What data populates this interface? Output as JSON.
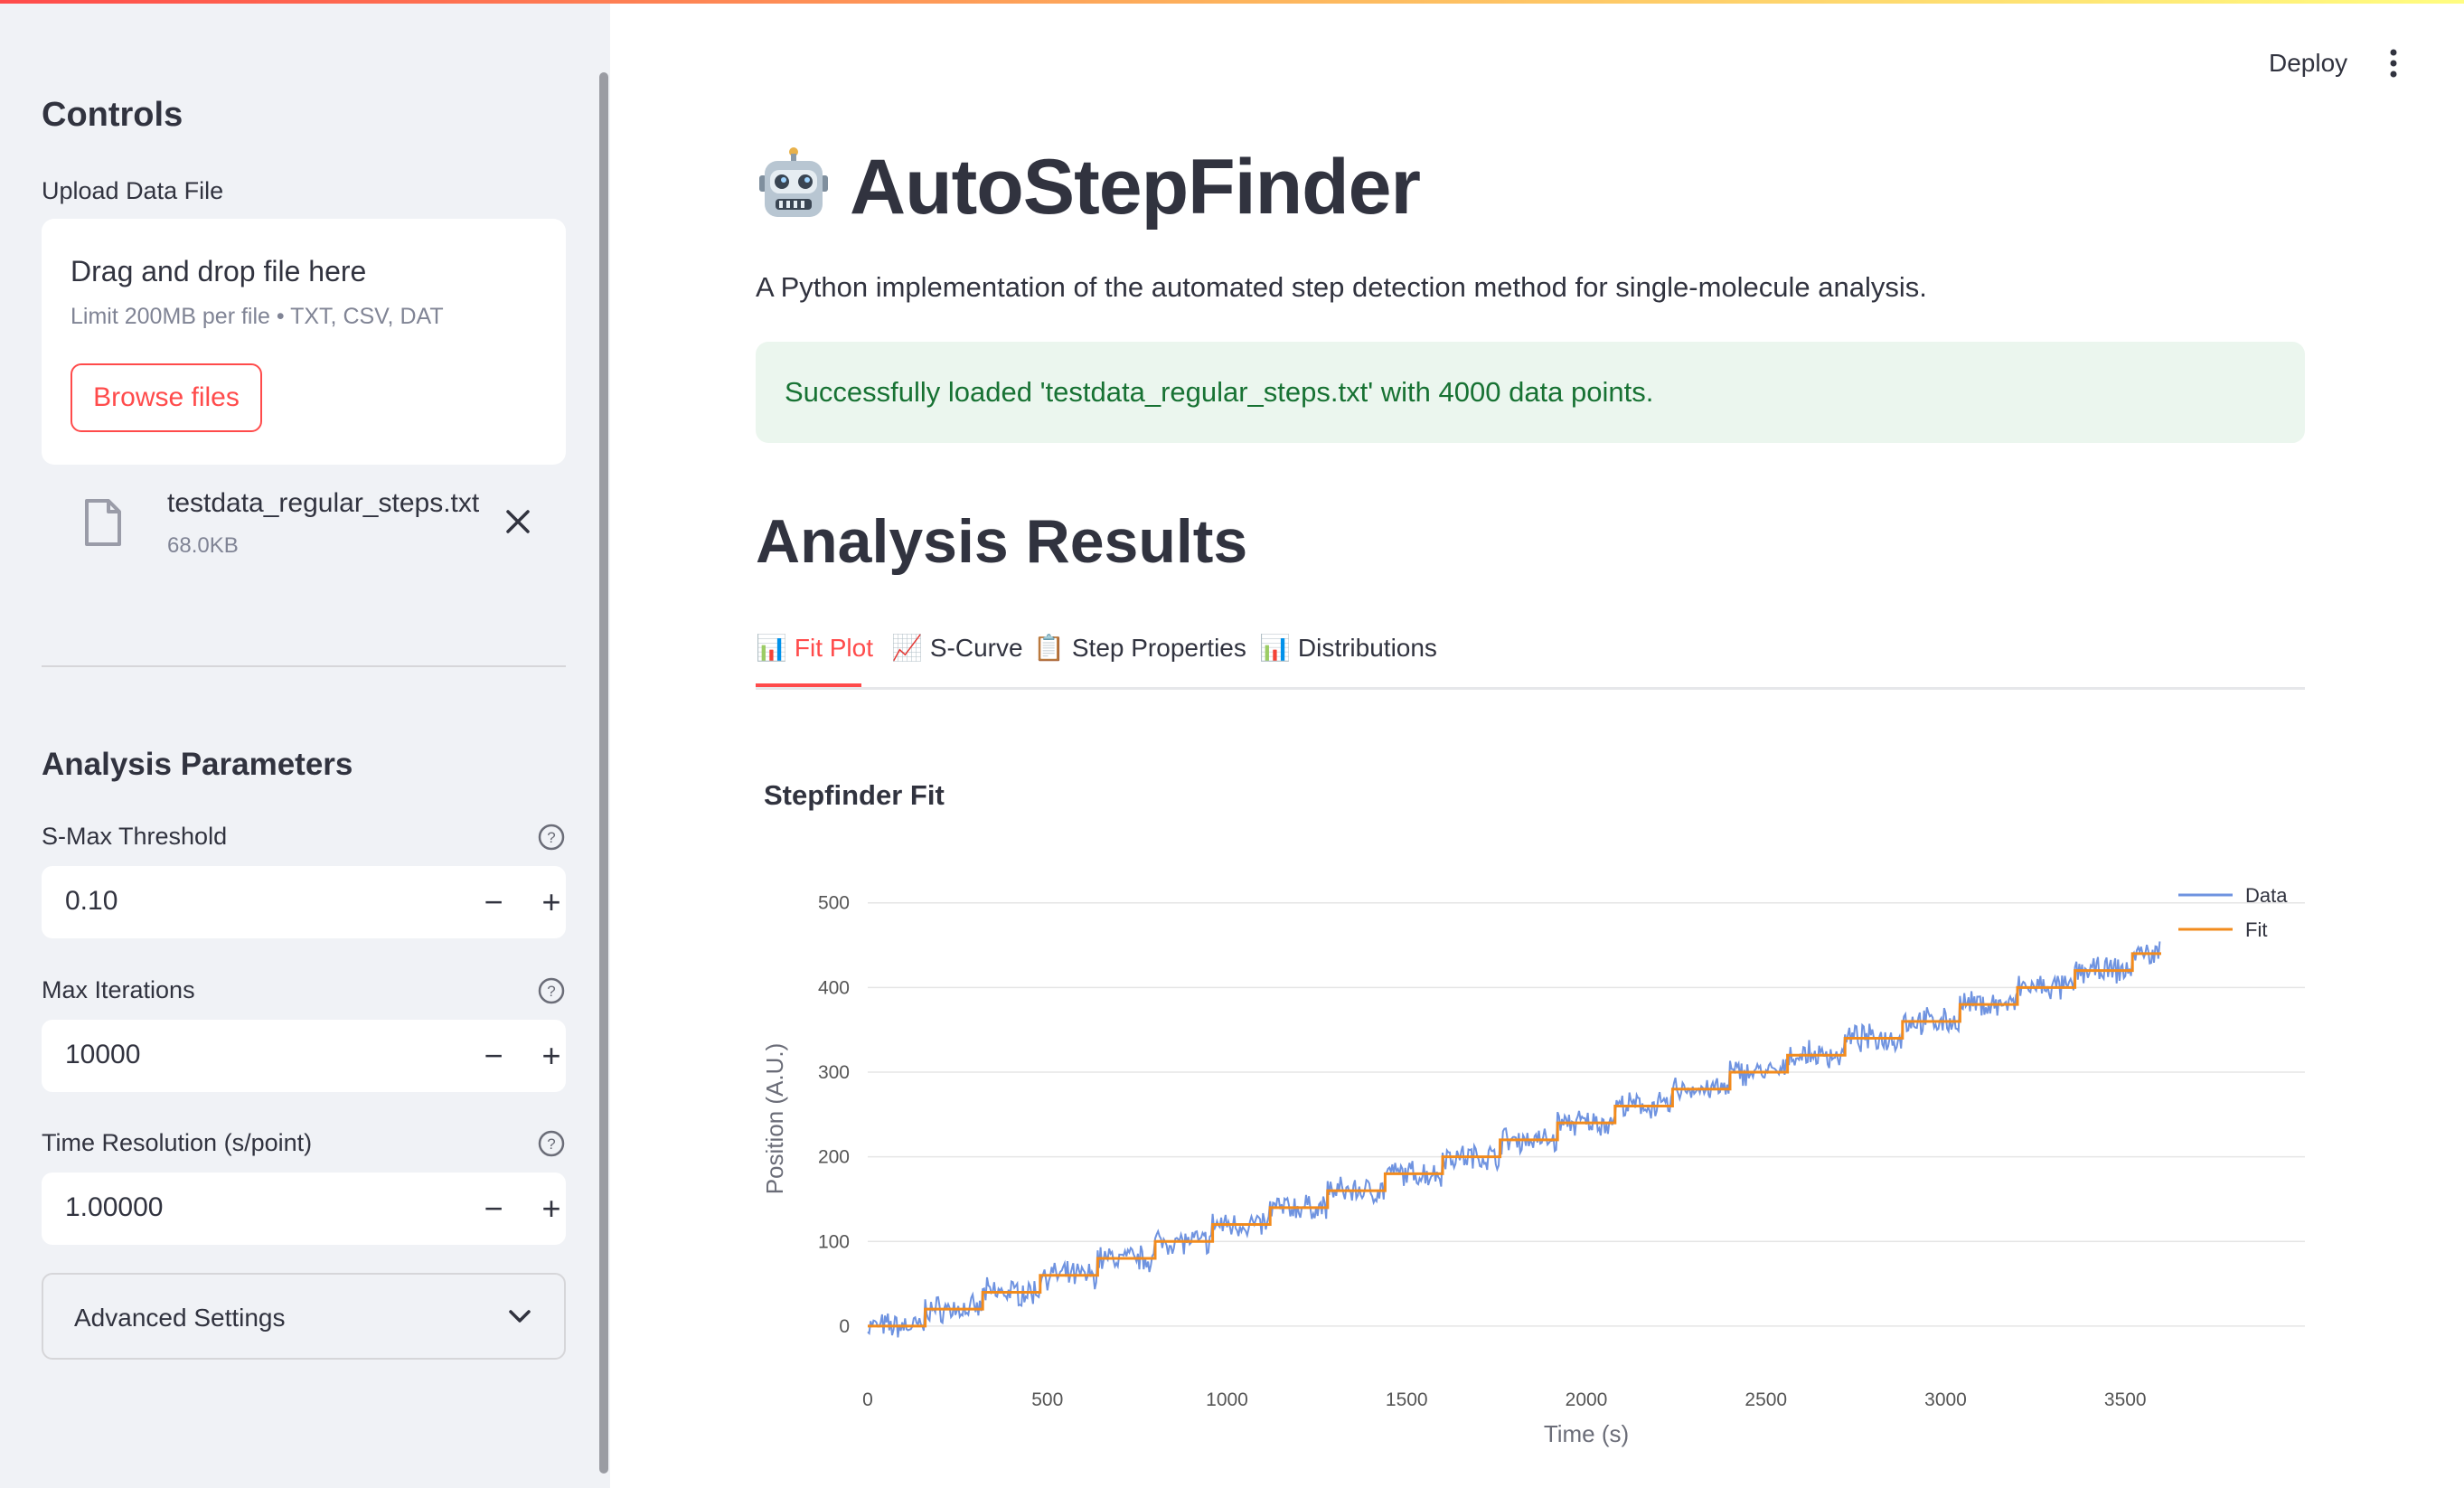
{
  "sidebar": {
    "title": "Controls",
    "upload_label": "Upload Data File",
    "uploader": {
      "main": "Drag and drop file here",
      "sub": "Limit 200MB per file • TXT, CSV, DAT",
      "browse_label": "Browse files"
    },
    "file": {
      "name": "testdata_regular_steps.txt",
      "size": "68.0KB"
    },
    "params_title": "Analysis Parameters",
    "params": [
      {
        "label": "S-Max Threshold",
        "value": "0.10"
      },
      {
        "label": "Max Iterations",
        "value": "10000"
      },
      {
        "label": "Time Resolution (s/point)",
        "value": "1.00000"
      }
    ],
    "advanced_label": "Advanced Settings"
  },
  "header": {
    "deploy_label": "Deploy"
  },
  "main": {
    "title": "AutoStepFinder",
    "description": "A Python implementation of the automated step detection method for single-molecule analysis.",
    "alert": "Successfully loaded 'testdata_regular_steps.txt' with 4000 data points.",
    "section_title": "Analysis Results",
    "tabs": [
      {
        "icon": "📊",
        "label": "Fit Plot"
      },
      {
        "icon": "📈",
        "label": "S-Curve"
      },
      {
        "icon": "📋",
        "label": "Step Properties"
      },
      {
        "icon": "📊",
        "label": "Distributions"
      }
    ],
    "chart_title": "Stepfinder Fit"
  },
  "colors": {
    "accent": "#ff4b4b",
    "data": "#6f93e0",
    "fit": "#f28b1d",
    "success": "#177233"
  },
  "chart_data": {
    "type": "line",
    "xlabel": "Time (s)",
    "ylabel": "Position (A.U.)",
    "xlim": [
      0,
      4000
    ],
    "ylim": [
      -30,
      520
    ],
    "xticks": [
      0,
      500,
      1000,
      1500,
      2000,
      2500,
      3000,
      3500
    ],
    "yticks": [
      0,
      100,
      200,
      300,
      400,
      500
    ],
    "legend": [
      "Data",
      "Fit"
    ],
    "legend_position": "top-right",
    "grid": true,
    "series": [
      {
        "name": "Fit",
        "steps": [
          {
            "x0": 0,
            "x1": 160,
            "y": 0
          },
          {
            "x0": 160,
            "x1": 320,
            "y": 20
          },
          {
            "x0": 320,
            "x1": 480,
            "y": 40
          },
          {
            "x0": 480,
            "x1": 640,
            "y": 60
          },
          {
            "x0": 640,
            "x1": 800,
            "y": 80
          },
          {
            "x0": 800,
            "x1": 960,
            "y": 100
          },
          {
            "x0": 960,
            "x1": 1120,
            "y": 120
          },
          {
            "x0": 1120,
            "x1": 1280,
            "y": 140
          },
          {
            "x0": 1280,
            "x1": 1440,
            "y": 160
          },
          {
            "x0": 1440,
            "x1": 1600,
            "y": 180
          },
          {
            "x0": 1600,
            "x1": 1760,
            "y": 200
          },
          {
            "x0": 1760,
            "x1": 1920,
            "y": 220
          },
          {
            "x0": 1920,
            "x1": 2080,
            "y": 240
          },
          {
            "x0": 2080,
            "x1": 2240,
            "y": 260
          },
          {
            "x0": 2240,
            "x1": 2400,
            "y": 280
          },
          {
            "x0": 2400,
            "x1": 2560,
            "y": 300
          },
          {
            "x0": 2560,
            "x1": 2720,
            "y": 320
          },
          {
            "x0": 2720,
            "x1": 2880,
            "y": 340
          },
          {
            "x0": 2880,
            "x1": 3040,
            "y": 360
          },
          {
            "x0": 3040,
            "x1": 3200,
            "y": 380
          },
          {
            "x0": 3200,
            "x1": 3360,
            "y": 400
          },
          {
            "x0": 3360,
            "x1": 3520,
            "y": 420
          },
          {
            "x0": 3520,
            "x1": 3600,
            "y": 440
          }
        ]
      },
      {
        "name": "Data",
        "noise_amplitude": 12
      }
    ]
  }
}
